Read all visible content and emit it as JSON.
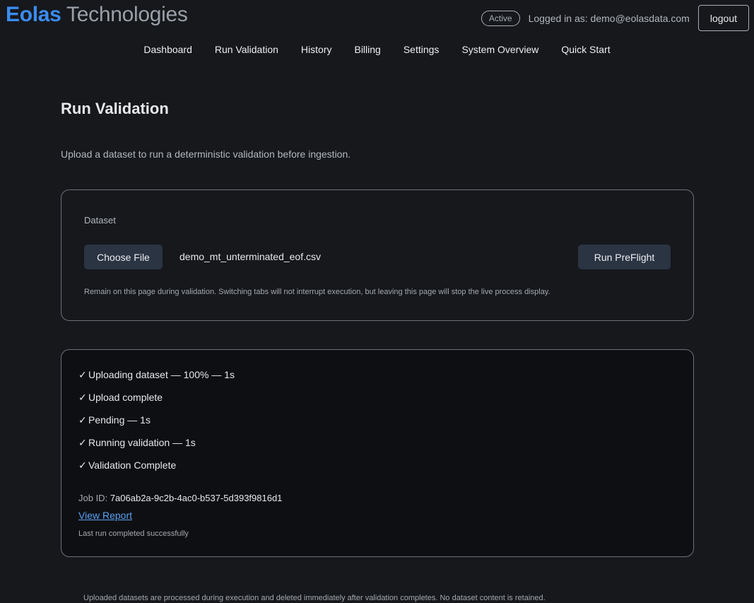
{
  "brand": {
    "primary": "Eolas",
    "secondary": " Technologies"
  },
  "header": {
    "status": "Active",
    "user_text": "Logged in as: demo@eolasdata.com",
    "logout_label": "logout"
  },
  "nav": {
    "items": [
      "Dashboard",
      "Run Validation",
      "History",
      "Billing",
      "Settings",
      "System Overview",
      "Quick Start"
    ]
  },
  "main": {
    "title": "Run Validation",
    "subtitle": "Upload a dataset to run a deterministic validation before ingestion."
  },
  "upload": {
    "label": "Dataset",
    "choose_file_label": "Choose File",
    "file_name": "demo_mt_unterminated_eof.csv",
    "run_label": "Run PreFlight",
    "helper": "Remain on this page during validation. Switching tabs will not interrupt execution, but leaving this page will stop the live process display."
  },
  "progress": {
    "check_glyph": "✓",
    "steps": [
      "Uploading dataset — 100% — 1s",
      "Upload complete",
      "Pending — 1s",
      "Running validation — 1s",
      "Validation Complete"
    ],
    "job_label": "Job ID:",
    "job_id": "7a06ab2a-9c2b-4ac0-b537-5d393f9816d1",
    "view_report_label": "View Report",
    "last_run": "Last run completed successfully"
  },
  "footer": {
    "note": "Uploaded datasets are processed during execution and deleted immediately after validation completes. No dataset content is retained."
  },
  "colors": {
    "background": "#16181c",
    "brand_blue": "#3b8cf2",
    "button": "#2b3443",
    "link": "#5aa2f5"
  }
}
